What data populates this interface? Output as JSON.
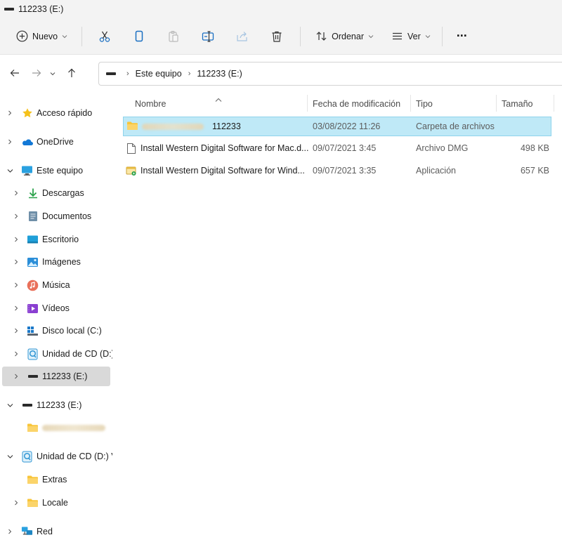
{
  "window": {
    "title": "112233 (E:)"
  },
  "toolbar": {
    "new_label": "Nuevo",
    "sort_label": "Ordenar",
    "view_label": "Ver",
    "more_label": "···"
  },
  "address": {
    "crumbs": [
      "Este equipo",
      "112233 (E:)"
    ]
  },
  "sidebar": {
    "items": [
      {
        "label": "Acceso rápido",
        "icon": "star-icon"
      },
      {
        "label": "OneDrive",
        "icon": "cloud-icon"
      },
      {
        "label": "Este equipo",
        "icon": "monitor-icon"
      },
      {
        "label": "Descargas",
        "icon": "download-icon"
      },
      {
        "label": "Documentos",
        "icon": "document-icon"
      },
      {
        "label": "Escritorio",
        "icon": "desktop-icon"
      },
      {
        "label": "Imágenes",
        "icon": "image-icon"
      },
      {
        "label": "Música",
        "icon": "music-icon"
      },
      {
        "label": "Vídeos",
        "icon": "video-icon"
      },
      {
        "label": "Disco local (C:)",
        "icon": "local-disk-icon"
      },
      {
        "label": "Unidad de CD (D:)",
        "icon": "cd-drive-icon"
      },
      {
        "label": "112233 (E:)",
        "icon": "usb-drive-icon"
      },
      {
        "label": "112233 (E:)",
        "icon": "usb-drive-icon"
      },
      {
        "label": "",
        "icon": "folder-icon"
      },
      {
        "label": "Unidad de CD (D:) V",
        "icon": "cd-drive-icon"
      },
      {
        "label": "Extras",
        "icon": "folder-icon"
      },
      {
        "label": "Locale",
        "icon": "folder-icon"
      },
      {
        "label": "Red",
        "icon": "network-icon"
      }
    ]
  },
  "columns": {
    "name": "Nombre",
    "modified": "Fecha de modificación",
    "type": "Tipo",
    "size": "Tamaño"
  },
  "files": [
    {
      "name": "112233",
      "modified": "03/08/2022 11:26",
      "type": "Carpeta de archivos",
      "size": "",
      "icon": "folder-icon"
    },
    {
      "name": "Install Western Digital Software for Mac.d...",
      "modified": "09/07/2021 3:45",
      "type": "Archivo DMG",
      "size": "498 KB",
      "icon": "file-icon"
    },
    {
      "name": "Install Western Digital Software for Wind...",
      "modified": "09/07/2021 3:35",
      "type": "Aplicación",
      "size": "657 KB",
      "icon": "application-icon"
    }
  ],
  "colors": {
    "selection_bg": "#bfe9f7",
    "selection_border": "#8fd3ec",
    "sidebar_selected": "#d9d9d9",
    "folder": "#f8c53a"
  }
}
